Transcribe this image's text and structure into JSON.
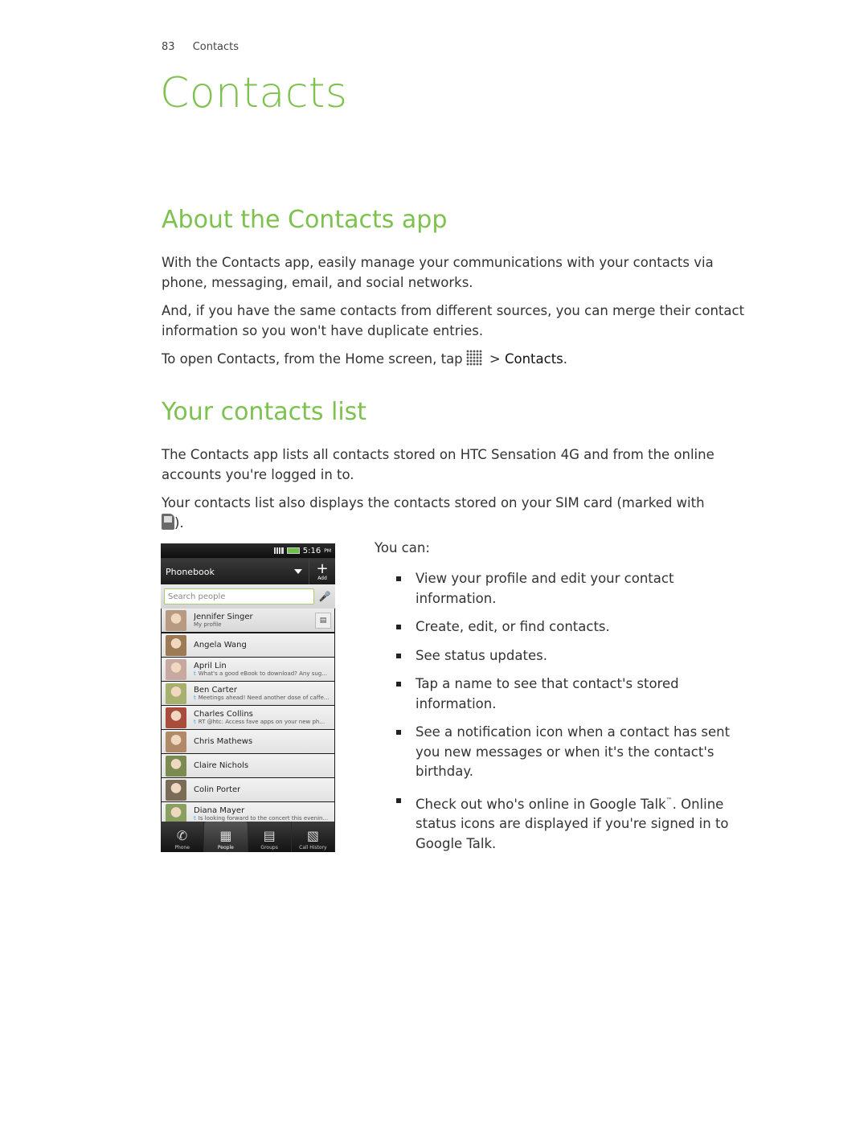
{
  "header": {
    "page_number": "83",
    "section": "Contacts"
  },
  "chapter_title": "Contacts",
  "sections": {
    "about": {
      "heading": "About the Contacts app",
      "paragraphs": [
        "With the Contacts app, easily manage your communications with your contacts via phone, messaging, email, and social networks.",
        "And, if you have the same contacts from different sources, you can merge their contact information so you won't have duplicate entries."
      ],
      "open_instruction": {
        "prefix": "To open Contacts, from the Home screen, tap",
        "icon": "all-apps-grid-icon",
        "separator": ">",
        "target": "Contacts",
        "suffix": "."
      }
    },
    "list": {
      "heading": "Your contacts list",
      "paragraph1": "The Contacts app lists all contacts stored on HTC Sensation 4G and from the online accounts you're logged in to.",
      "paragraph2_prefix": "Your contacts list also displays the contacts stored on your SIM card (marked with",
      "paragraph2_icon": "sim-card-icon",
      "paragraph2_suffix": ").",
      "you_can": "You can:",
      "bullets": [
        "View your profile and edit your contact information.",
        "Create, edit, or find contacts.",
        "See status updates.",
        "Tap a name to see that contact's stored information.",
        "See a notification icon when a contact has sent you new messages or when it's the contact's birthday."
      ],
      "last_bullet": {
        "part1": "Check out who's online in Google Talk",
        "tm": "™",
        "part2": ". Online status icons are displayed if you're signed in to Google Talk."
      }
    }
  },
  "phone": {
    "time": "5:16",
    "ampm": "PM",
    "title": "Phonebook",
    "add_label": "Add",
    "search_placeholder": "Search people",
    "contacts": [
      {
        "name": "Jennifer Singer",
        "status": "My profile",
        "twitter": false,
        "color": "#b89a82"
      },
      {
        "name": "Angela Wang",
        "status": "",
        "twitter": false,
        "color": "#9b7a55"
      },
      {
        "name": "April Lin",
        "status": "What's a good eBook to download? Any sug...",
        "twitter": true,
        "color": "#c7a9a0"
      },
      {
        "name": "Ben Carter",
        "status": "Meetings ahead! Need another dose of caffe...",
        "twitter": true,
        "color": "#a8b070"
      },
      {
        "name": "Charles Collins",
        "status": "RT @htc: Access fave apps on your new ph...",
        "twitter": true,
        "color": "#a84c3c"
      },
      {
        "name": "Chris Mathews",
        "status": "",
        "twitter": false,
        "color": "#b08a68"
      },
      {
        "name": "Claire Nichols",
        "status": "",
        "twitter": false,
        "color": "#7a8a50"
      },
      {
        "name": "Colin Porter",
        "status": "",
        "twitter": false,
        "color": "#7a6a58"
      },
      {
        "name": "Diana Mayer",
        "status": "Is looking forward to the concert this evenin...",
        "twitter": true,
        "color": "#8aa060"
      }
    ],
    "tabs": [
      {
        "label": "Phone",
        "icon": "phone-icon",
        "glyph": "✆"
      },
      {
        "label": "People",
        "icon": "people-icon",
        "glyph": "▦"
      },
      {
        "label": "Groups",
        "icon": "groups-icon",
        "glyph": "▤"
      },
      {
        "label": "Call History",
        "icon": "call-history-icon",
        "glyph": "▧"
      }
    ],
    "active_tab": "People"
  }
}
